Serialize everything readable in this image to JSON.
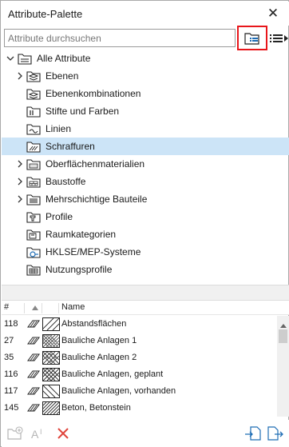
{
  "window": {
    "title": "Attribute-Palette"
  },
  "search": {
    "placeholder": "Attribute durchsuchen",
    "value": ""
  },
  "tree": {
    "root": {
      "label": "Alle Attribute"
    },
    "items": [
      {
        "label": "Ebenen",
        "expandable": true,
        "icon": "layers-icon"
      },
      {
        "label": "Ebenenkombinationen",
        "expandable": false,
        "icon": "layer-combinations-icon"
      },
      {
        "label": "Stifte und Farben",
        "expandable": false,
        "icon": "pens-colors-icon"
      },
      {
        "label": "Linien",
        "expandable": false,
        "icon": "lines-icon"
      },
      {
        "label": "Schraffuren",
        "expandable": false,
        "icon": "fills-icon",
        "selected": true
      },
      {
        "label": "Oberflächenmaterialien",
        "expandable": true,
        "icon": "surfaces-icon"
      },
      {
        "label": "Baustoffe",
        "expandable": true,
        "icon": "building-materials-icon"
      },
      {
        "label": "Mehrschichtige Bauteile",
        "expandable": true,
        "icon": "composites-icon"
      },
      {
        "label": "Profile",
        "expandable": false,
        "icon": "profiles-icon"
      },
      {
        "label": "Raumkategorien",
        "expandable": false,
        "icon": "zone-categories-icon"
      },
      {
        "label": "HKLSE/MEP-Systeme",
        "expandable": false,
        "icon": "mep-systems-icon"
      },
      {
        "label": "Nutzungsprofile",
        "expandable": false,
        "icon": "operation-profiles-icon"
      }
    ]
  },
  "table": {
    "headers": {
      "num": "#",
      "sort": "sort-icon",
      "name": "Name"
    },
    "rows": [
      {
        "num": "118",
        "name": "Abstandsflächen",
        "pattern": "diagonal-wide"
      },
      {
        "num": "27",
        "name": "Bauliche Anlagen 1",
        "pattern": "dense-dots"
      },
      {
        "num": "35",
        "name": "Bauliche Anlagen 2",
        "pattern": "crosshatch-dots"
      },
      {
        "num": "116",
        "name": "Bauliche Anlagen, geplant",
        "pattern": "crosshatch"
      },
      {
        "num": "117",
        "name": "Bauliche Anlagen, vorhanden",
        "pattern": "diagonal-back"
      },
      {
        "num": "145",
        "name": "Beton, Betonstein",
        "pattern": "diagonal-dense"
      }
    ]
  },
  "colors": {
    "selection": "#cce4f7",
    "highlight_border": "#e8161b",
    "delete_red": "#e0443c",
    "icon_blue": "#1f6db5"
  }
}
